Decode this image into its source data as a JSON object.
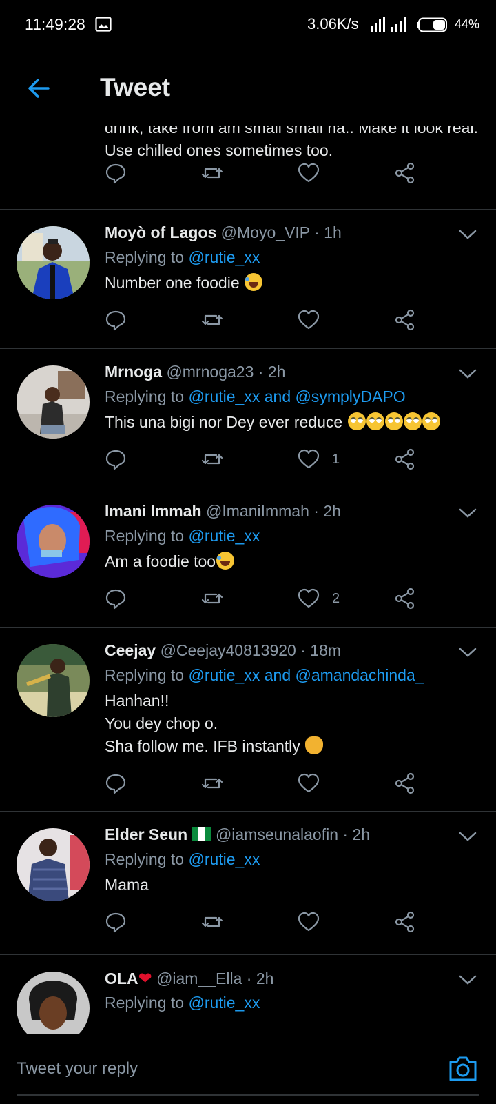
{
  "status_bar": {
    "time": "11:49:28",
    "speed": "3.06K/s",
    "battery": "44%"
  },
  "header": {
    "title": "Tweet"
  },
  "top_fragment": {
    "body": "drink, take from am small small na.. Make it look real. Use chilled ones sometimes too."
  },
  "tweets": [
    {
      "name": "Moyò of Lagos",
      "handle": "@Moyo_VIP",
      "time": "· 1h",
      "replying_prefix": "Replying to",
      "replying_to": "@rutie_xx",
      "body": "Number one foodie",
      "likes": ""
    },
    {
      "name": "Mrnoga",
      "handle": "@mrnoga23",
      "time": "· 2h",
      "replying_prefix": "Replying to",
      "replying_to": "@rutie_xx and @symplyDAPO",
      "body": "This una bigi nor Dey ever reduce",
      "likes": "1"
    },
    {
      "name": "Imani Immah",
      "handle": "@ImaniImmah",
      "time": "· 2h",
      "replying_prefix": "Replying to",
      "replying_to": "@rutie_xx",
      "body": "Am a foodie too",
      "likes": "2"
    },
    {
      "name": "Ceejay",
      "handle": "@Ceejay40813920",
      "time": "· 18m",
      "replying_prefix": "Replying to",
      "replying_to": "@rutie_xx and @amandachinda_",
      "body": "Hanhan!!\nYou dey chop o.\nSha follow me. IFB instantly",
      "likes": ""
    },
    {
      "name": "Elder Seun",
      "handle": "@iamseunalaofin",
      "time": "· 2h",
      "replying_prefix": "Replying to",
      "replying_to": "@rutie_xx",
      "body": "Mama",
      "likes": ""
    },
    {
      "name": "OLA",
      "handle": "@iam__Ella",
      "time": "· 2h",
      "replying_prefix": "Replying to",
      "replying_to": "@rutie_xx",
      "body": "",
      "likes": ""
    }
  ],
  "composer": {
    "placeholder": "Tweet your reply"
  },
  "icons": [
    "image-icon",
    "signal-icon",
    "battery-icon",
    "back-arrow-icon",
    "chevron-down-icon",
    "reply-icon",
    "retweet-icon",
    "like-icon",
    "share-icon",
    "camera-icon"
  ],
  "colors": {
    "background": "#000000",
    "accent": "#1d9bf0",
    "text": "#e7e9ea",
    "muted": "#8b98a5",
    "divider": "#2f3336"
  }
}
